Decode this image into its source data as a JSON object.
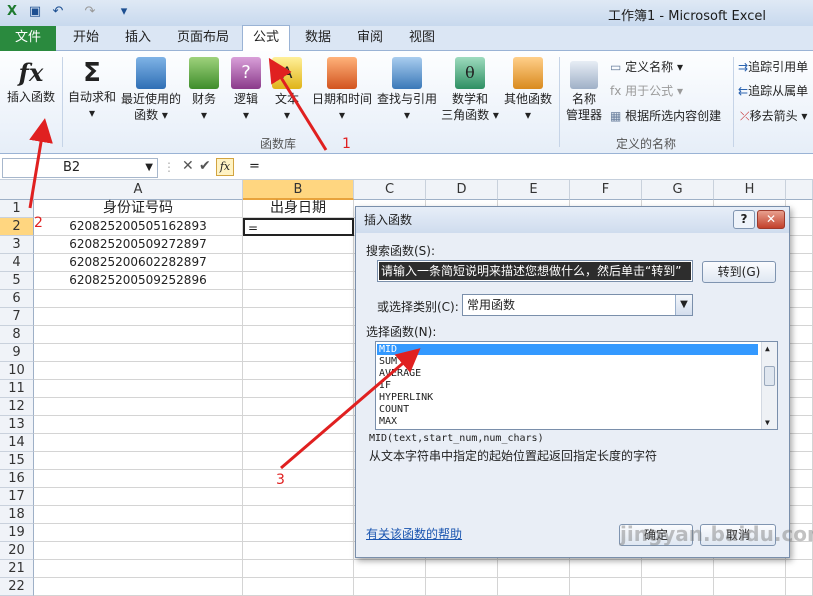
{
  "window": {
    "title": "工作簿1 - Microsoft Excel"
  },
  "menubar": {
    "file": "文件",
    "tabs": [
      "开始",
      "插入",
      "页面布局",
      "公式",
      "数据",
      "审阅",
      "视图"
    ],
    "active": "公式"
  },
  "ribbon": {
    "insert_function": "插入函数",
    "buttons": [
      {
        "l1": "自动求和",
        "l2": "▾"
      },
      {
        "l1": "最近使用的",
        "l2": "函数 ▾"
      },
      {
        "l1": "财务",
        "l2": "▾"
      },
      {
        "l1": "逻辑",
        "l2": "▾"
      },
      {
        "l1": "文本",
        "l2": "▾"
      },
      {
        "l1": "日期和时间",
        "l2": "▾"
      },
      {
        "l1": "查找与引用",
        "l2": "▾"
      },
      {
        "l1": "数学和",
        "l2": "三角函数 ▾"
      },
      {
        "l1": "其他函数",
        "l2": "▾"
      }
    ],
    "group_library": "函数库",
    "name_manager_l1": "名称",
    "name_manager_l2": "管理器",
    "define_name": "定义名称 ▾",
    "use_in_formula": "用于公式 ▾",
    "create_from_selection": "根据所选内容创建",
    "group_names": "定义的名称",
    "trace_precedents": "追踪引用单",
    "trace_dependents": "追踪从属单",
    "remove_arrows": "移去箭头 ▾"
  },
  "formula_bar": {
    "name_box": "B2",
    "content": "="
  },
  "sheet": {
    "columns": [
      "A",
      "B",
      "C",
      "D",
      "E",
      "F",
      "G",
      "H"
    ],
    "rows": [
      "1",
      "2",
      "3",
      "4",
      "5",
      "6",
      "7",
      "8",
      "9",
      "10",
      "11",
      "12",
      "13",
      "14",
      "15",
      "16",
      "17",
      "18",
      "19",
      "20",
      "21",
      "22"
    ],
    "header_a": "身份证号码",
    "header_b": "出身日期",
    "ids": [
      "620825200505162893",
      "620825200509272897",
      "620825200602282897",
      "620825200509252896"
    ],
    "b2": "="
  },
  "dialog": {
    "title": "插入函数",
    "search_label": "搜索函数(S):",
    "search_text": "请输入一条简短说明来描述您想做什么，然后单击“转到”",
    "go_button": "转到(G)",
    "category_label": "或选择类别(C):",
    "category": "常用函数",
    "select_label": "选择函数(N):",
    "functions": [
      "MID",
      "SUM",
      "AVERAGE",
      "IF",
      "HYPERLINK",
      "COUNT",
      "MAX"
    ],
    "signature": "MID(text,start_num,num_chars)",
    "description": "从文本字符串中指定的起始位置起返回指定长度的字符",
    "help_link": "有关该函数的帮助",
    "ok": "确定",
    "cancel": "取消"
  },
  "annotations": [
    "1",
    "2",
    "3"
  ],
  "watermark": "jingyan.baidu.com"
}
